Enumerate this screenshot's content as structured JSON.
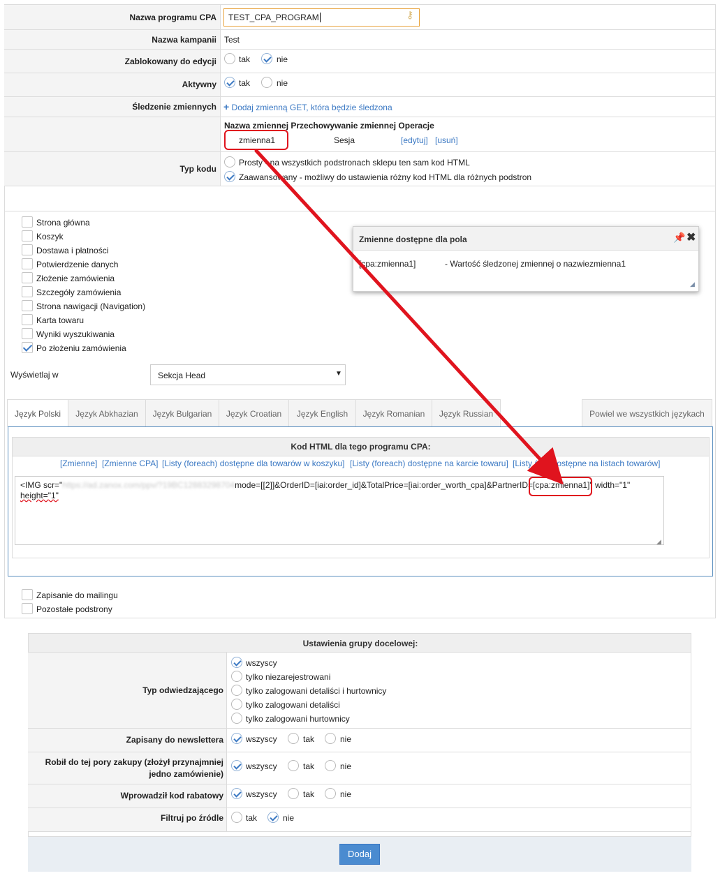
{
  "form": {
    "program_label": "Nazwa programu CPA",
    "program_value": "TEST_CPA_PROGRAM",
    "campaign_label": "Nazwa kampanii",
    "campaign_value": "Test",
    "locked_label": "Zablokowany do edycji",
    "active_label": "Aktywny",
    "yes": "tak",
    "no": "nie",
    "tracking_label": "Śledzenie zmiennych",
    "add_var_link": "Dodaj zmienną GET, która będzie śledzona",
    "var_header": "Nazwa zmiennej Przechowywanie zmiennej Operacje",
    "var_name": "zmienna1",
    "var_storage": "Sesja",
    "var_edit": "[edytuj]",
    "var_delete": "[usuń]",
    "code_type_label": "Typ kodu",
    "code_simple": "Prosty - na wszystkich podstronach sklepu ten sam kod HTML",
    "code_advanced": "Zaawansowany - możliwy do ustawienia różny kod HTML dla różnych podstron"
  },
  "pages": [
    {
      "label": "Strona główna",
      "checked": false
    },
    {
      "label": "Koszyk",
      "checked": false
    },
    {
      "label": "Dostawa i płatności",
      "checked": false
    },
    {
      "label": "Potwierdzenie danych",
      "checked": false
    },
    {
      "label": "Złożenie zamówienia",
      "checked": false
    },
    {
      "label": "Szczegóły zamówienia",
      "checked": false
    },
    {
      "label": "Strona nawigacji (Navigation)",
      "checked": false
    },
    {
      "label": "Karta towaru",
      "checked": false
    },
    {
      "label": "Wyniki wyszukiwania",
      "checked": false
    },
    {
      "label": "Po złożeniu zamówienia",
      "checked": true
    }
  ],
  "popup": {
    "title": "Zmienne dostępne dla pola",
    "var": "[cpa:zmienna1]",
    "desc": "- Wartość śledzonej zmiennej o nazwiezmienna1"
  },
  "display": {
    "label": "Wyświetlaj w",
    "selected": "Sekcja Head"
  },
  "tabs": [
    "Język Polski",
    "Język Abkhazian",
    "Język Bulgarian",
    "Język Croatian",
    "Język English",
    "Język Romanian",
    "Język Russian"
  ],
  "tab_copy_all": "Powiel we wszystkich językach",
  "code": {
    "header": "Kod HTML dla tego programu CPA:",
    "links": [
      "[Zmienne]",
      "[Zmienne CPA]",
      "[Listy (foreach) dostępne dla towarów w koszyku]",
      "[Listy (foreach) dostępne na karcie towaru]",
      "[Listy (for) dostępne na listach towarów]"
    ],
    "pre": "<IMG scr=\"",
    "blurred": "https://ad.zanox.com/ppv/?19BC12883298704",
    "mid": "mode=[[2]]&OrderID=[iai:order_id]&TotalPrice=[iai:order_worth_cpa]&PartnerID=",
    "cpa_var": "[cpa:zmienna1]",
    "post": "\" width=\"1\"",
    "line2": "height=\"1\""
  },
  "extra_pages": [
    {
      "label": "Zapisanie do mailingu",
      "checked": false
    },
    {
      "label": "Pozostałe podstrony",
      "checked": false
    }
  ],
  "target": {
    "header": "Ustawienia grupy docelowej:",
    "visitor_label": "Typ odwiedzającego",
    "visitor_options": [
      "wszyscy",
      "tylko niezarejestrowani",
      "tylko zalogowani detaliści i hurtownicy",
      "tylko zalogowani detaliści",
      "tylko zalogowani hurtownicy"
    ],
    "newsletter_label": "Zapisany do newslettera",
    "purchase_label": "Robił do tej pory zakupy (złożył przynajmniej jedno zamówienie)",
    "coupon_label": "Wprowadził kod rabatowy",
    "source_label": "Filtruj po źródle",
    "all": "wszyscy",
    "yes": "tak",
    "no": "nie"
  },
  "submit": "Dodaj",
  "colors": {
    "accent": "#3a78c3",
    "highlight": "#e0141e",
    "input_focus": "#e8a33c"
  }
}
